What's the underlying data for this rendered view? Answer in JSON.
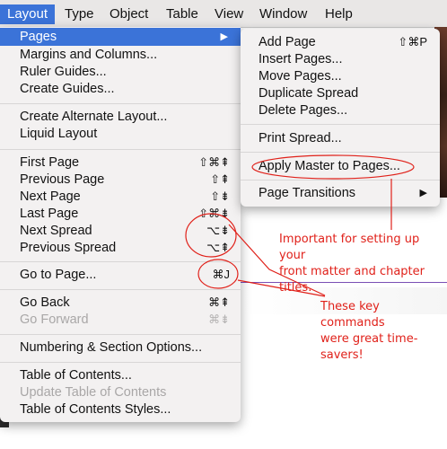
{
  "menubar": {
    "items": [
      "Layout",
      "Type",
      "Object",
      "Table",
      "View",
      "Window",
      "Help"
    ]
  },
  "layout_menu": {
    "pages": "Pages",
    "margins": "Margins and Columns...",
    "ruler_guides": "Ruler Guides...",
    "create_guides": "Create Guides...",
    "alt_layout": "Create Alternate Layout...",
    "liquid_layout": "Liquid Layout",
    "first_page": "First Page",
    "first_page_sc": "⇧⌘⇞",
    "previous_page": "Previous Page",
    "previous_page_sc": "⇧⇞",
    "next_page": "Next Page",
    "next_page_sc": "⇧⇟",
    "last_page": "Last Page",
    "last_page_sc": "⇧⌘⇟",
    "next_spread": "Next Spread",
    "next_spread_sc": "⌥⇟",
    "previous_spread": "Previous Spread",
    "previous_spread_sc": "⌥⇞",
    "go_to_page": "Go to Page...",
    "go_to_page_sc": "⌘J",
    "go_back": "Go Back",
    "go_back_sc": "⌘⇞",
    "go_forward": "Go Forward",
    "go_forward_sc": "⌘⇟",
    "numbering": "Numbering & Section Options...",
    "toc": "Table of Contents...",
    "update_toc": "Update Table of Contents",
    "toc_styles": "Table of Contents Styles..."
  },
  "pages_submenu": {
    "add_page": "Add Page",
    "add_page_sc": "⇧⌘P",
    "insert_pages": "Insert Pages...",
    "move_pages": "Move Pages...",
    "duplicate_spread": "Duplicate Spread",
    "delete_pages": "Delete Pages...",
    "print_spread": "Print Spread...",
    "apply_master": "Apply Master to Pages...",
    "page_transitions": "Page Transitions"
  },
  "annotations": {
    "note1": [
      "Important for setting up your",
      "front matter and chapter",
      "titles."
    ],
    "note2": [
      "These key commands",
      "were great time-",
      "savers!"
    ],
    "color": "#e0211a"
  },
  "colors": {
    "highlight": "#3b73d8",
    "menu_bg": "#f3f1f1"
  }
}
